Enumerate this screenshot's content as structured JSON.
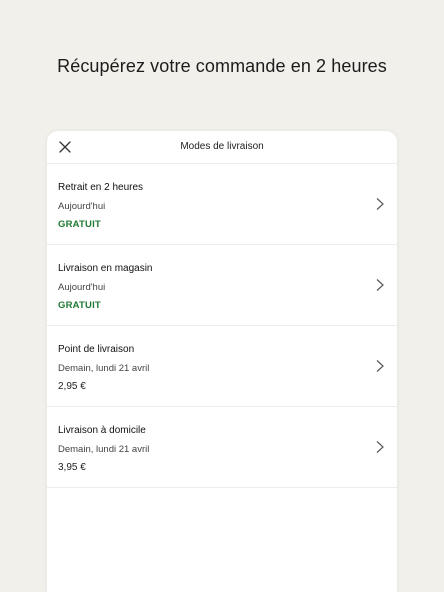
{
  "headline": "Récupérez votre commande en 2 heures",
  "sheet": {
    "title": "Modes de livraison",
    "close_icon": "close-icon",
    "options": [
      {
        "title": "Retrait en 2 heures",
        "date": "Aujourd'hui",
        "price": "GRATUIT",
        "free": true
      },
      {
        "title": "Livraison en magasin",
        "date": "Aujourd'hui",
        "price": "GRATUIT",
        "free": true
      },
      {
        "title": "Point de livraison",
        "date": "Demain, lundi 21 avril",
        "price": "2,95 €",
        "free": false
      },
      {
        "title": "Livraison à domicile",
        "date": "Demain, lundi 21 avril",
        "price": "3,95 €",
        "free": false
      }
    ]
  },
  "colors": {
    "background": "#f2f0eb",
    "free_price": "#1f7a33"
  }
}
